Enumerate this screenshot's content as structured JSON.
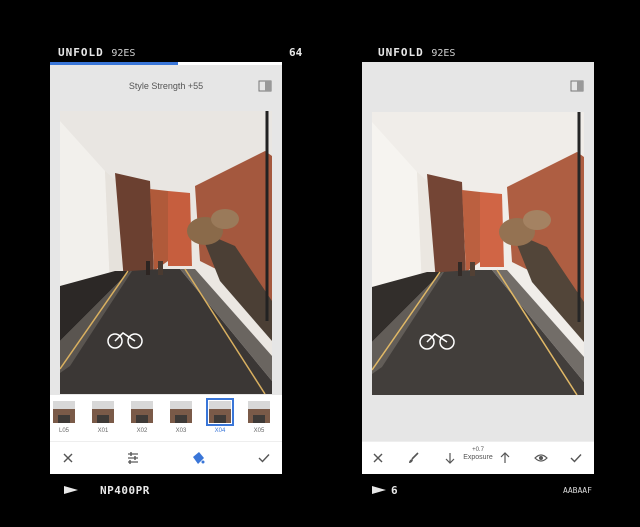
{
  "left_frame": {
    "brand": "UNFOLD",
    "brand_sub": "92ES",
    "frame_number": "64",
    "bottom_label": "NP400PR"
  },
  "right_frame": {
    "brand": "UNFOLD",
    "brand_sub": "92ES",
    "frame_number": "6",
    "code": "AABAAF"
  },
  "left_screen": {
    "title": "Style Strength +55",
    "progress_fraction": 0.55,
    "filters": [
      {
        "label": "L05",
        "active": false
      },
      {
        "label": "X01",
        "active": false
      },
      {
        "label": "X02",
        "active": false
      },
      {
        "label": "X03",
        "active": false
      },
      {
        "label": "X04",
        "active": true
      },
      {
        "label": "X05",
        "active": false
      }
    ],
    "toolbar": [
      "close-icon",
      "sliders-icon",
      "paint-bucket-icon",
      "check-icon"
    ],
    "accent_color": "#3a76d8"
  },
  "right_screen": {
    "exposure_value": "+0.7",
    "exposure_label": "Exposure",
    "toolbar": [
      "close-icon",
      "brush-icon",
      "arrow-down-icon",
      "arrow-up-icon",
      "eye-icon",
      "check-icon"
    ]
  }
}
